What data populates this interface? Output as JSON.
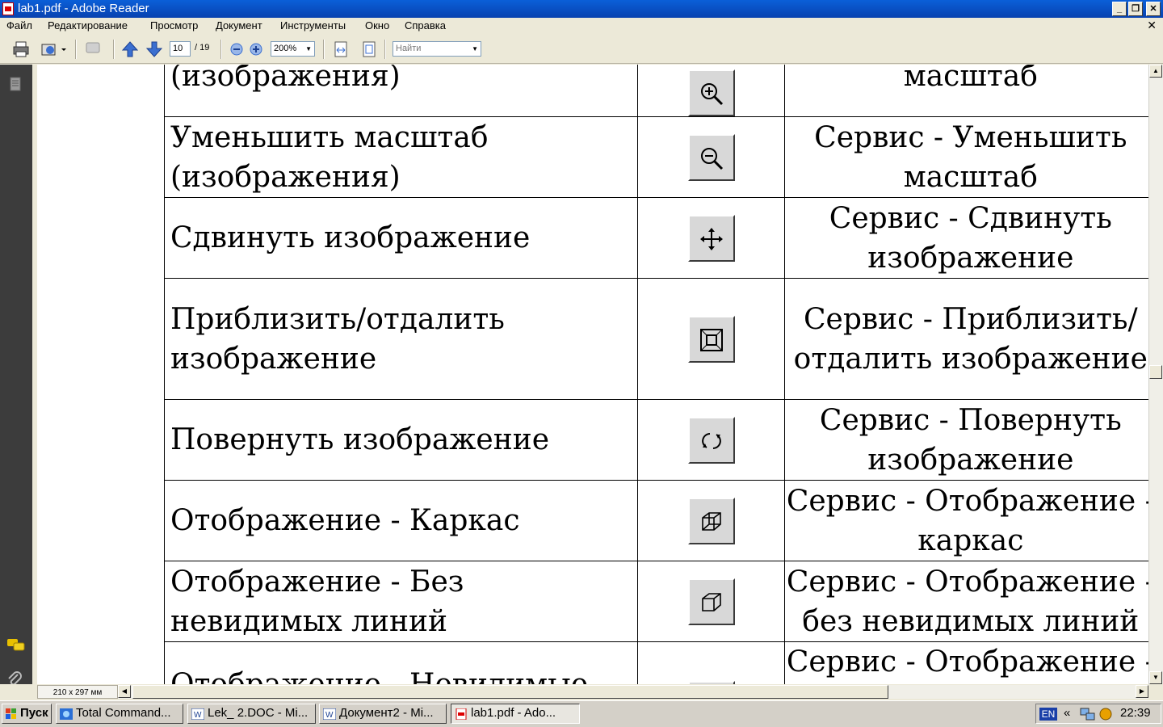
{
  "window": {
    "title": "lab1.pdf - Adobe Reader"
  },
  "menu": [
    "Файл",
    "Редактирование",
    "Просмотр",
    "Документ",
    "Инструменты",
    "Окно",
    "Справка"
  ],
  "toolbar": {
    "page_current": "10",
    "page_total": "/ 19",
    "zoom": "200%",
    "search_placeholder": "Найти"
  },
  "status": {
    "page_size": "210 x 297 мм"
  },
  "table": {
    "rows": [
      {
        "action": "(изображения)",
        "icon": "zoom-in-icon",
        "menu_path": "масштаб"
      },
      {
        "action": "Уменьшить масштаб (изображения)",
        "icon": "zoom-out-icon",
        "menu_path": "Сервис - Уменьшить масштаб"
      },
      {
        "action": "Сдвинуть изображение",
        "icon": "pan-icon",
        "menu_path": "Сервис - Сдвинуть изображение"
      },
      {
        "action": "Приблизить/отдалить изображение",
        "icon": "zoom-window-icon",
        "menu_path": "Сервис - Приблизить/отдалить изображение"
      },
      {
        "action": "Повернуть изображение",
        "icon": "rotate-icon",
        "menu_path": "Сервис - Повернуть изображение"
      },
      {
        "action": "Отображение - Каркас",
        "icon": "wireframe-icon",
        "menu_path": "Сервис - Отображение - каркас"
      },
      {
        "action": "Отображение - Без невидимых линий",
        "icon": "hidden-lines-removed-icon",
        "menu_path": "Сервис - Отображение - без невидимых линий"
      },
      {
        "action": "Отображение - Невидимые",
        "icon": "hidden-lines-icon",
        "menu_path": "Сервис - Отображение -"
      }
    ]
  },
  "taskbar": {
    "start": "Пуск",
    "tasks": [
      {
        "label": "Total Command...",
        "icon": "total-commander-icon"
      },
      {
        "label": "Lek_ 2.DOC - Mi...",
        "icon": "word-icon"
      },
      {
        "label": "Документ2 - Mi...",
        "icon": "word-icon"
      },
      {
        "label": "lab1.pdf - Ado...",
        "icon": "pdf-icon"
      }
    ],
    "language": "EN",
    "clock": "22:39"
  }
}
